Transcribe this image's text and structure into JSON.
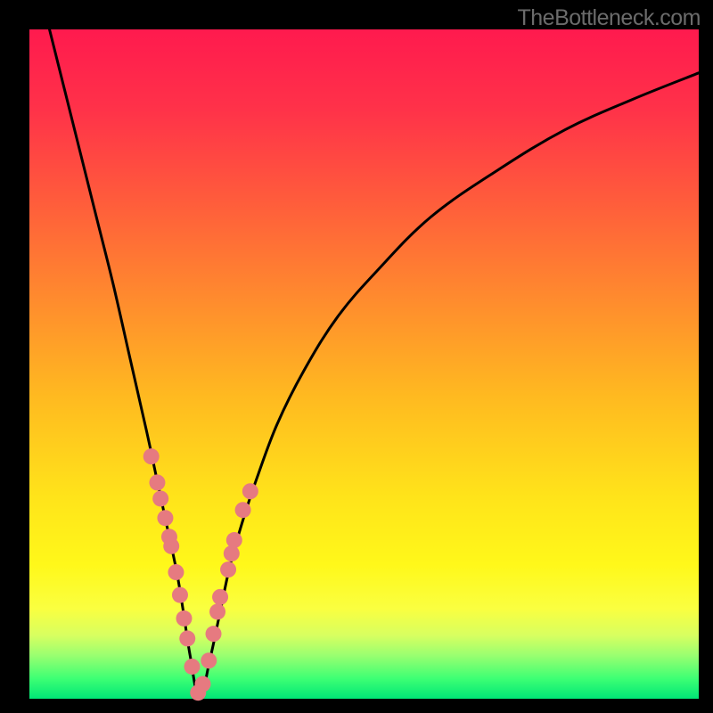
{
  "watermark": "TheBottleneck.com",
  "colors": {
    "bg": "#000000",
    "curve": "#000000",
    "dot_fill": "#e67a80",
    "dot_stroke": "#d06068",
    "gradient_stops": [
      {
        "offset": 0.0,
        "color": "#ff1a4e"
      },
      {
        "offset": 0.12,
        "color": "#ff3249"
      },
      {
        "offset": 0.25,
        "color": "#ff5a3c"
      },
      {
        "offset": 0.4,
        "color": "#ff8a2e"
      },
      {
        "offset": 0.55,
        "color": "#ffba20"
      },
      {
        "offset": 0.7,
        "color": "#ffe41a"
      },
      {
        "offset": 0.8,
        "color": "#fff81a"
      },
      {
        "offset": 0.865,
        "color": "#faff40"
      },
      {
        "offset": 0.905,
        "color": "#d8ff60"
      },
      {
        "offset": 0.935,
        "color": "#9aff70"
      },
      {
        "offset": 0.97,
        "color": "#3dff74"
      },
      {
        "offset": 1.0,
        "color": "#00e676"
      }
    ]
  },
  "chart_data": {
    "type": "line",
    "title": "",
    "xlabel": "",
    "ylabel": "",
    "xlim": [
      0,
      100
    ],
    "ylim": [
      0,
      100
    ],
    "x_optimum": 25.4,
    "series": [
      {
        "name": "bottleneck-curve",
        "x": [
          3.0,
          5.0,
          7.5,
          10.0,
          12.5,
          15.0,
          17.5,
          19.0,
          20.5,
          22.0,
          23.0,
          24.0,
          25.4,
          27.0,
          28.5,
          30.0,
          32.0,
          34.0,
          37.0,
          41.0,
          46.0,
          52.0,
          60.0,
          70.0,
          80.0,
          90.0,
          100.0
        ],
        "y": [
          100,
          92,
          82,
          72,
          62,
          51,
          40,
          33,
          26,
          19,
          13,
          6.5,
          0.0,
          6.0,
          13,
          20,
          27,
          33,
          41,
          49,
          57,
          64,
          72,
          79,
          85,
          89.5,
          93.5
        ]
      }
    ],
    "dots": {
      "name": "sample-points",
      "x": [
        18.2,
        19.1,
        19.6,
        20.3,
        20.9,
        21.2,
        21.9,
        22.5,
        23.1,
        23.6,
        24.3,
        25.2,
        25.9,
        26.8,
        27.5,
        28.1,
        28.5,
        29.7,
        30.2,
        30.6,
        31.9,
        33.0
      ],
      "y": [
        36.2,
        32.3,
        29.9,
        27.0,
        24.2,
        22.8,
        18.9,
        15.5,
        12.0,
        9.0,
        4.8,
        0.9,
        2.2,
        5.7,
        9.7,
        13.0,
        15.2,
        19.3,
        21.7,
        23.7,
        28.2,
        31.0
      ]
    }
  }
}
